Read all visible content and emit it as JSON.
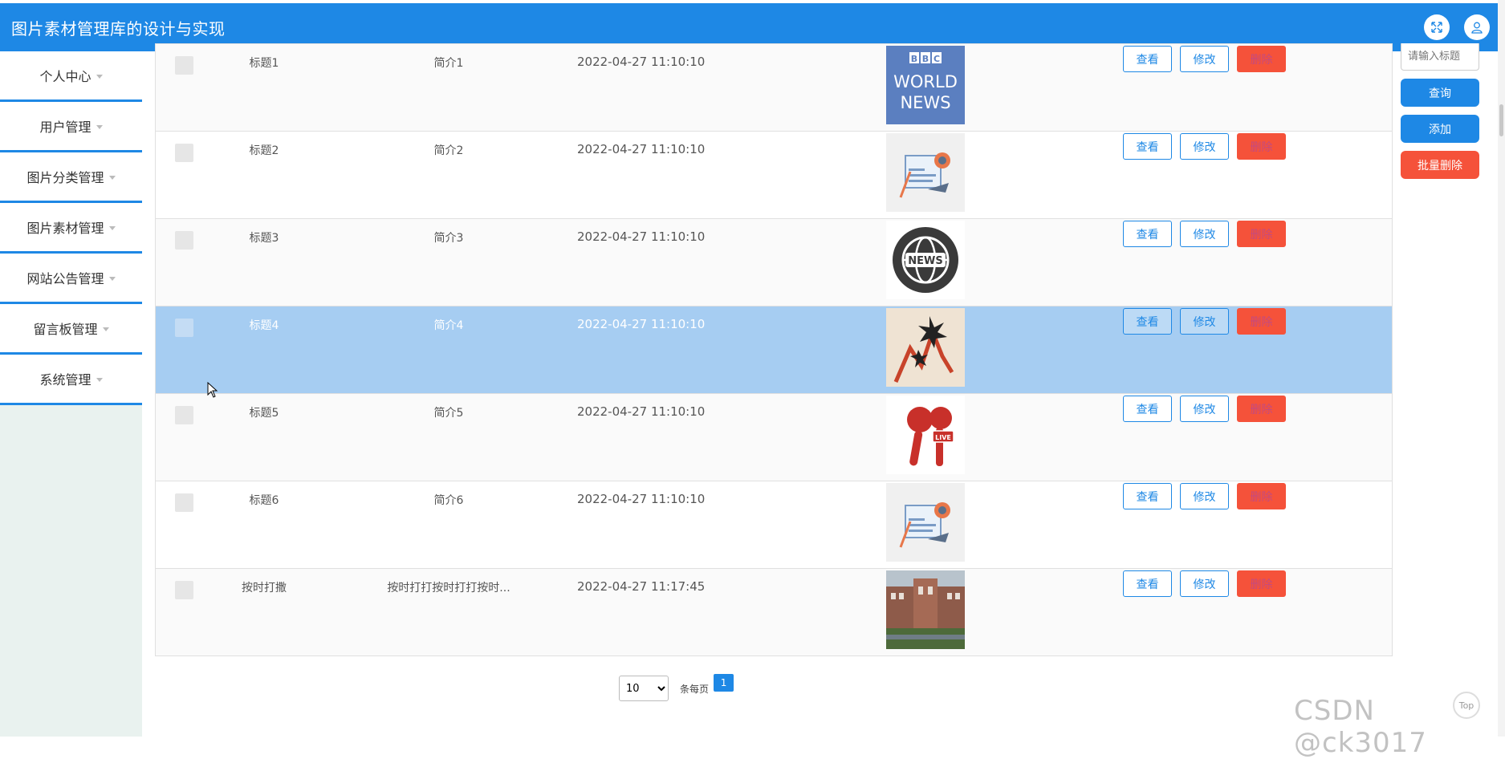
{
  "app": {
    "title": "图片素材管理库的设计与实现"
  },
  "header_icons": [
    "fullscreen-icon",
    "user-icon"
  ],
  "sidebar": {
    "items": [
      {
        "label": "个人中心"
      },
      {
        "label": "用户管理"
      },
      {
        "label": "图片分类管理"
      },
      {
        "label": "图片素材管理"
      },
      {
        "label": "网站公告管理"
      },
      {
        "label": "留言板管理"
      },
      {
        "label": "系统管理"
      }
    ]
  },
  "table": {
    "rows": [
      {
        "title": "标题1",
        "intro": "简介1",
        "date": "2022-04-27 11:10:10",
        "image": "BBC WORLD NEWS",
        "selected": false
      },
      {
        "title": "标题2",
        "intro": "简介2",
        "date": "2022-04-27 11:10:10",
        "image": "news-paper-illustration",
        "selected": false
      },
      {
        "title": "标题3",
        "intro": "简介3",
        "date": "2022-04-27 11:10:10",
        "image": "NEWS",
        "selected": false
      },
      {
        "title": "标题4",
        "intro": "简介4",
        "date": "2022-04-27 11:10:10",
        "image": "stock-chart-illustration",
        "selected": true
      },
      {
        "title": "标题5",
        "intro": "简介5",
        "date": "2022-04-27 11:10:10",
        "image": "LIVE",
        "selected": false
      },
      {
        "title": "标题6",
        "intro": "简介6",
        "date": "2022-04-27 11:10:10",
        "image": "news-paper-illustration",
        "selected": false
      },
      {
        "title": "按时打撒",
        "intro": "按时打打按时打打按时...",
        "date": "2022-04-27 11:17:45",
        "image": "campus-building-photo",
        "selected": false
      }
    ],
    "actions": {
      "view": "查看",
      "edit": "修改",
      "delete": "删除"
    }
  },
  "side_panel": {
    "search_placeholder": "请输入标题",
    "query_label": "查询",
    "add_label": "添加",
    "batch_delete_label": "批量删除"
  },
  "pagination": {
    "page_size": "10",
    "page_size_options": [
      "10"
    ],
    "per_page_label": "条每页",
    "current_page": "1"
  },
  "watermark": "CSDN @ck3017",
  "back_to_top": "Top",
  "colors": {
    "primary": "#1e88e5",
    "danger": "#f5523a",
    "selected_row": "#a6cdf2",
    "sidebar_bg": "#e9f2ef"
  }
}
